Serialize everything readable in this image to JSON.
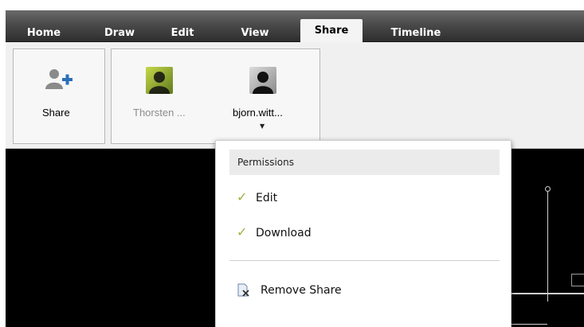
{
  "tabs": [
    {
      "label": "Home",
      "active": false
    },
    {
      "label": "Draw",
      "active": false
    },
    {
      "label": "Edit",
      "active": false
    },
    {
      "label": "View",
      "active": false
    },
    {
      "label": "Share",
      "active": true
    },
    {
      "label": "Timeline",
      "active": false
    }
  ],
  "ribbon": {
    "share_label": "Share",
    "users": [
      {
        "name": "Thorsten ...",
        "dimmed": true
      },
      {
        "name": "bjorn.witt...",
        "dimmed": false
      }
    ],
    "dropdown_arrow": "▼"
  },
  "popup": {
    "header": "Permissions",
    "items": [
      {
        "label": "Edit",
        "checked": true
      },
      {
        "label": "Download",
        "checked": true
      }
    ],
    "remove_label": "Remove Share"
  },
  "icons": {
    "share": "add-user-icon",
    "check": "checkmark-icon",
    "remove": "remove-share-icon"
  },
  "colors": {
    "check": "#9ab23a",
    "tab_active_bg": "#f4f4f4",
    "canvas_bg": "#000000"
  }
}
